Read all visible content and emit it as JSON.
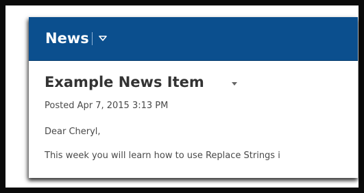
{
  "widget": {
    "title": "News",
    "menu_icon": "chevron-down-icon",
    "header_color": "#0b4f8e"
  },
  "news_item": {
    "title": "Example News Item",
    "menu_icon": "caret-down-icon",
    "posted": "Posted Apr 7, 2015 3:13 PM",
    "greeting": "Dear Cheryl,",
    "body": "This week you will learn how to use Replace Strings i"
  }
}
